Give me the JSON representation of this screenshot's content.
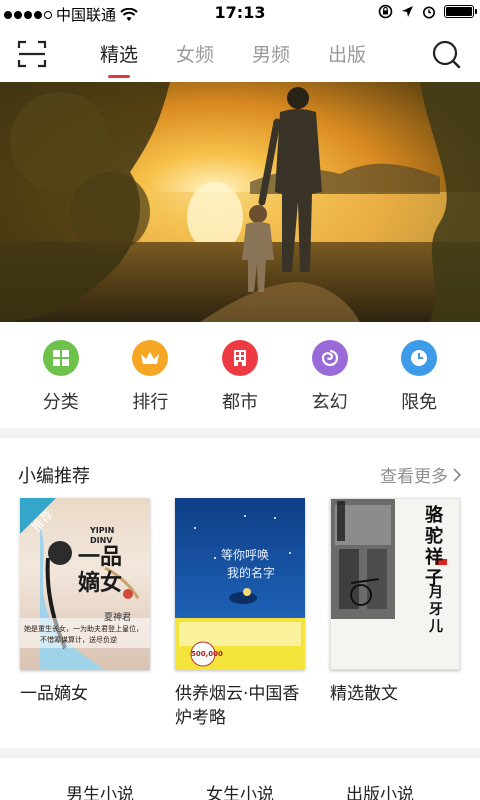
{
  "status_bar": {
    "carrier": "中国联通",
    "time": "17:13"
  },
  "top_nav": {
    "tabs": [
      {
        "label": "精选",
        "active": true
      },
      {
        "label": "女频",
        "active": false
      },
      {
        "label": "男频",
        "active": false
      },
      {
        "label": "出版",
        "active": false
      }
    ]
  },
  "categories": [
    {
      "label": "分类",
      "icon": "grid-icon",
      "color": "#6cc24a"
    },
    {
      "label": "排行",
      "icon": "crown-icon",
      "color": "#f5a623"
    },
    {
      "label": "都市",
      "icon": "building-icon",
      "color": "#ee3b43"
    },
    {
      "label": "玄幻",
      "icon": "swirl-icon",
      "color": "#9b6ad9"
    },
    {
      "label": "限免",
      "icon": "clock-icon",
      "color": "#3d9be9"
    }
  ],
  "recommend": {
    "title": "小编推荐",
    "more": "查看更多",
    "books": [
      {
        "title": "一品嫡女",
        "cover": {
          "badge": "推荐",
          "big_title": "一品嫡女",
          "pinyin": "YIPIN DINV",
          "author": "夏神君",
          "blurb_1": "她是重生长女，一为助夫君登上皇位，",
          "blurb_2": "不惜筹谋算计，送尽负逆"
        }
      },
      {
        "title": "供养烟云·中国香炉考略",
        "cover": {
          "line_1": "等你呼唤",
          "line_2": "我的名字",
          "sales": "500,000"
        }
      },
      {
        "title": "精选散文",
        "cover": {
          "title": "骆驼祥子",
          "author": "月牙儿"
        }
      }
    ]
  },
  "bottom_tabs": [
    "男生小说",
    "女生小说",
    "出版小说"
  ],
  "colors": {
    "accent": "#e0383e",
    "inactive_tab": "#9a9a9a",
    "divider": "#f2f2f2"
  }
}
